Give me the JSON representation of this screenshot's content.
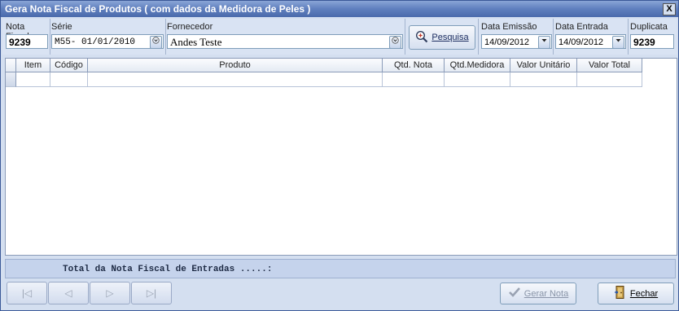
{
  "window": {
    "title": "Gera Nota Fiscal de Produtos ( com dados da Medidora de Peles )",
    "close_label": "X"
  },
  "form": {
    "nota_fiscal": {
      "label": "Nota Fiscal",
      "value": "9239"
    },
    "serie": {
      "label": "Série",
      "value": "M55- 01/01/2010"
    },
    "fornecedor": {
      "label": "Fornecedor",
      "value": "Andes Teste"
    },
    "pesquisa_label": "Pesquisa",
    "data_emissao": {
      "label": "Data Emissão",
      "value": "14/09/2012"
    },
    "data_entrada": {
      "label": "Data Entrada",
      "value": "14/09/2012"
    },
    "duplicata": {
      "label": "Duplicata",
      "value": "9239"
    }
  },
  "grid": {
    "columns": [
      "Item",
      "Código",
      "Produto",
      "Qtd. Nota",
      "Qtd.Medidora",
      "Valor Unitário",
      "Valor Total"
    ]
  },
  "footer": {
    "total_label": "Total da Nota Fiscal de Entradas .....:",
    "nav": {
      "first": "|◁",
      "prev": "◁",
      "next": "▷",
      "last": "▷|"
    },
    "gerar_nota_label": "Gerar Nota",
    "fechar_label": "Fechar"
  },
  "icons": {
    "dropdown": "chevron-down",
    "search": "magnifier-plus",
    "check": "check",
    "exit": "door-exit"
  }
}
